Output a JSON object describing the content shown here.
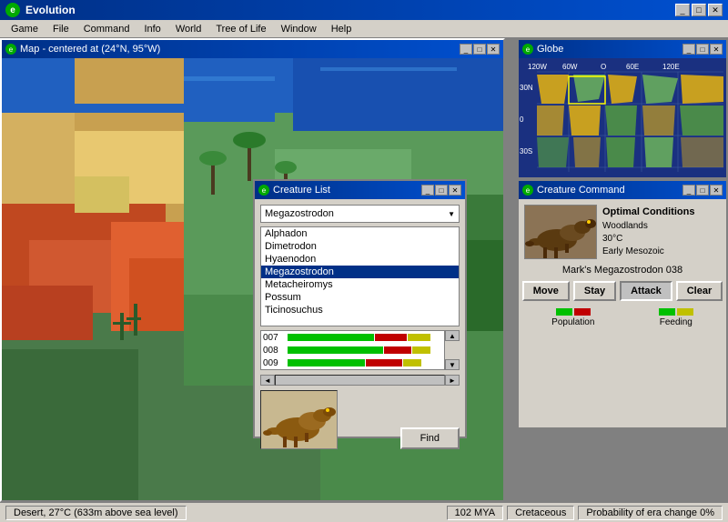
{
  "app": {
    "title": "Evolution",
    "icon": "e"
  },
  "titlebar": {
    "minimize": "_",
    "restore": "□",
    "close": "✕"
  },
  "menubar": {
    "items": [
      "Game",
      "File",
      "Command",
      "Info",
      "World",
      "Tree of Life",
      "Window",
      "Help"
    ]
  },
  "map_window": {
    "title": "Map - centered at (24°N, 95°W)"
  },
  "globe_window": {
    "title": "Globe",
    "lat_labels": [
      "30N",
      "0",
      "30S"
    ],
    "lon_labels": [
      "120W",
      "60W",
      "O",
      "60E",
      "120E"
    ]
  },
  "creature_cmd": {
    "title": "Creature Command",
    "creature_name": "Mark's Megazostrodon 038",
    "optimal_title": "Optimal Conditions",
    "biome": "Woodlands",
    "temp": "30°C",
    "era": "Early Mesozoic",
    "buttons": [
      "Move",
      "Stay",
      "Attack",
      "Clear"
    ],
    "active_button": "Attack",
    "stat_population_label": "Population",
    "stat_feeding_label": "Feeding"
  },
  "creature_list": {
    "title": "Creature List",
    "selected_dropdown": "Megazostrodon",
    "items": [
      "Alphadon",
      "Dimetrodon",
      "Hyaenodon",
      "Megazostrodon",
      "Metacheiromys",
      "Possum",
      "Ticinosuchus"
    ],
    "selected_item": "Megazostrodon",
    "bar_rows": [
      {
        "label": "007",
        "green": 55,
        "red": 25,
        "yellow": 15
      },
      {
        "label": "008",
        "green": 60,
        "red": 20,
        "yellow": 15
      },
      {
        "label": "009",
        "green": 50,
        "red": 30,
        "yellow": 15
      }
    ],
    "find_button": "Find"
  },
  "statusbar": {
    "terrain_info": "Desert, 27°C (633m above sea level)",
    "mya": "102 MYA",
    "era": "Cretaceous",
    "probability": "Probability of era change 0%"
  }
}
